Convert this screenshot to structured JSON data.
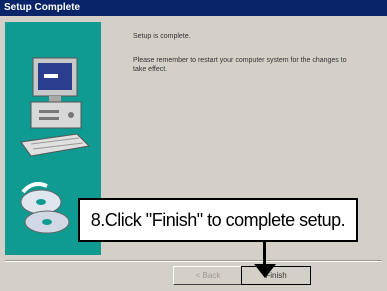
{
  "window": {
    "title": "Setup Complete"
  },
  "content": {
    "line1": "Setup is complete.",
    "line2": "Please remember to restart your computer system for the changes to take effect."
  },
  "buttons": {
    "back": "< Back",
    "finish": "Finish"
  },
  "callout": {
    "text": "8.Click \"Finish\" to complete setup."
  },
  "colors": {
    "titlebar": "#0a246a",
    "sidepanel": "#0f9a92",
    "dialog": "#d4d0c8"
  },
  "icons": {
    "side_illustration": "computer-and-cd-icon",
    "pointer": "down-arrow-icon"
  }
}
